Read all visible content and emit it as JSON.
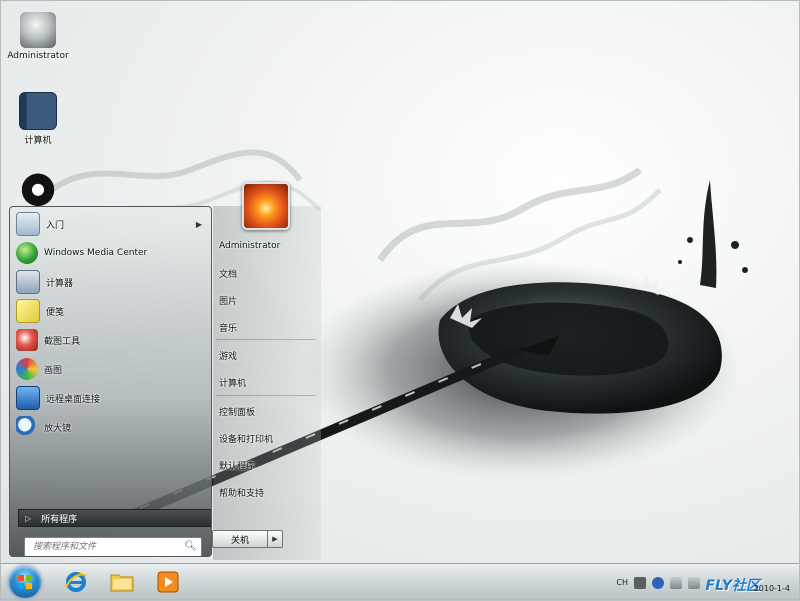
{
  "desktop": {
    "icons": [
      {
        "label": "Administrator",
        "icon": "user-folder-icon"
      },
      {
        "label": "计算机",
        "icon": "computer-notebook-icon"
      }
    ]
  },
  "start_menu": {
    "programs": [
      {
        "label": "入门",
        "icon": "getting-started-icon",
        "has_arrow": true
      },
      {
        "label": "Windows Media Center",
        "icon": "media-center-icon"
      },
      {
        "label": "计算器",
        "icon": "calculator-icon"
      },
      {
        "label": "便笺",
        "icon": "sticky-notes-icon"
      },
      {
        "label": "截图工具",
        "icon": "snipping-tool-icon"
      },
      {
        "label": "画图",
        "icon": "paint-icon"
      },
      {
        "label": "远程桌面连接",
        "icon": "remote-desktop-icon"
      },
      {
        "label": "放大镜",
        "icon": "magnifier-icon"
      }
    ],
    "all_programs": "所有程序",
    "search_placeholder": "搜索程序和文件",
    "right_items": [
      "Administrator",
      "文档",
      "图片",
      "音乐",
      "游戏",
      "计算机",
      "控制面板",
      "设备和打印机",
      "默认程序",
      "帮助和支持"
    ],
    "shutdown": "关机"
  },
  "taskbar": {
    "pinned": [
      {
        "name": "internet-explorer",
        "icon": "ie-icon"
      },
      {
        "name": "explorer",
        "icon": "folder-icon"
      },
      {
        "name": "media-player",
        "icon": "media-player-icon"
      }
    ],
    "tray": {
      "language": "CH",
      "watermark": "FLY社区",
      "date": "2010-1-4"
    }
  },
  "colors": {
    "accent": "#1e7fc9",
    "taskbar": "#cfd6d8"
  }
}
